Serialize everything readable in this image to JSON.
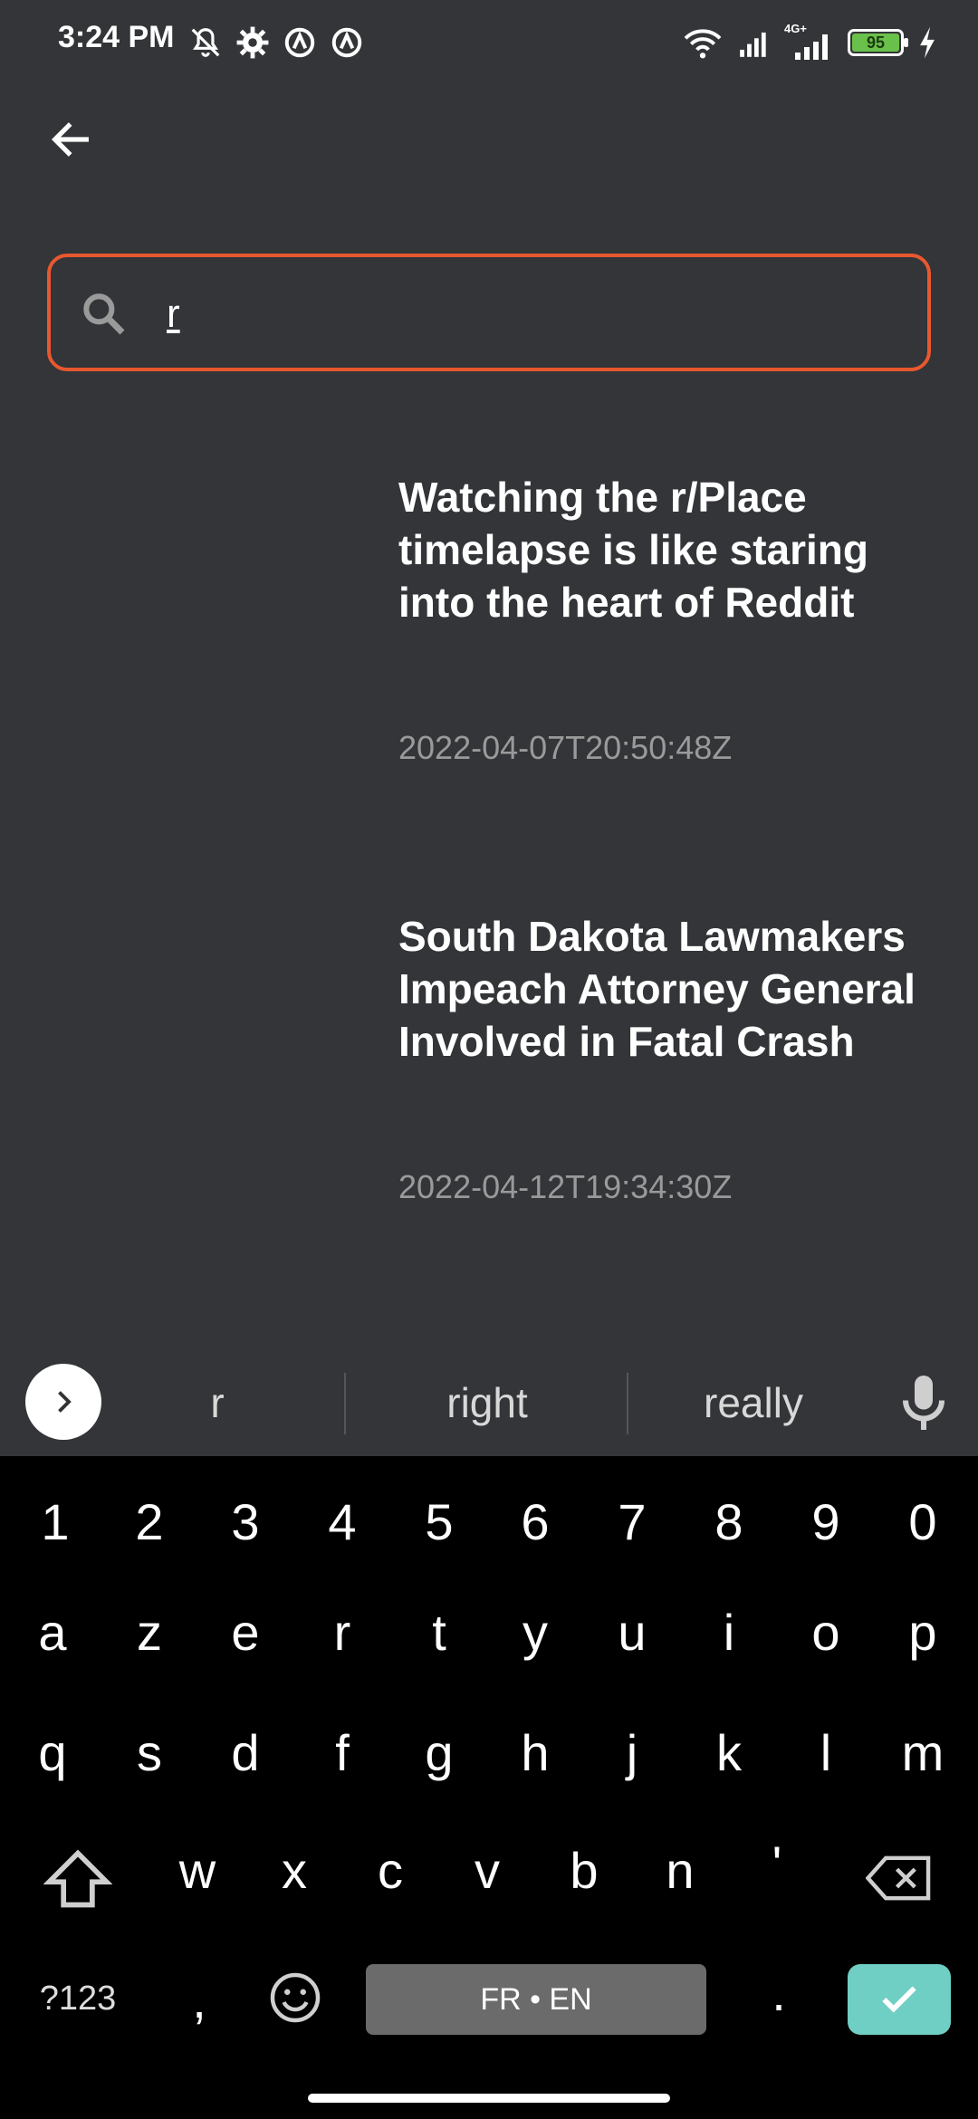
{
  "status_bar": {
    "time": "3:24 PM",
    "battery_level": "95",
    "network_label": "4G+",
    "icons_left": [
      "muted-bell-icon",
      "gear-icon",
      "circle-a-icon",
      "circle-a-icon"
    ],
    "icons_right": [
      "wifi-icon",
      "signal-icon",
      "signal-4g-icon",
      "battery-icon",
      "charging-icon"
    ]
  },
  "search": {
    "value": "r",
    "border_color": "#e8582f"
  },
  "results": [
    {
      "title": "Watching the r/Place timelapse is like staring into the heart of Reddit",
      "date": "2022-04-07T20:50:48Z"
    },
    {
      "title": "South Dakota Lawmakers Impeach Attorney General Involved in Fatal Crash",
      "date": "2022-04-12T19:34:30Z"
    }
  ],
  "suggestions": [
    "r",
    "right",
    "really"
  ],
  "keyboard": {
    "row_numbers": [
      "1",
      "2",
      "3",
      "4",
      "5",
      "6",
      "7",
      "8",
      "9",
      "0"
    ],
    "row1": [
      "a",
      "z",
      "e",
      "r",
      "t",
      "y",
      "u",
      "i",
      "o",
      "p"
    ],
    "row2": [
      "q",
      "s",
      "d",
      "f",
      "g",
      "h",
      "j",
      "k",
      "l",
      "m"
    ],
    "row3": [
      "w",
      "x",
      "c",
      "v",
      "b",
      "n",
      "'"
    ],
    "symbols_label": "?123",
    "comma": ",",
    "space_label": "FR • EN",
    "period": ".",
    "enter_color": "#6fcfc4"
  }
}
